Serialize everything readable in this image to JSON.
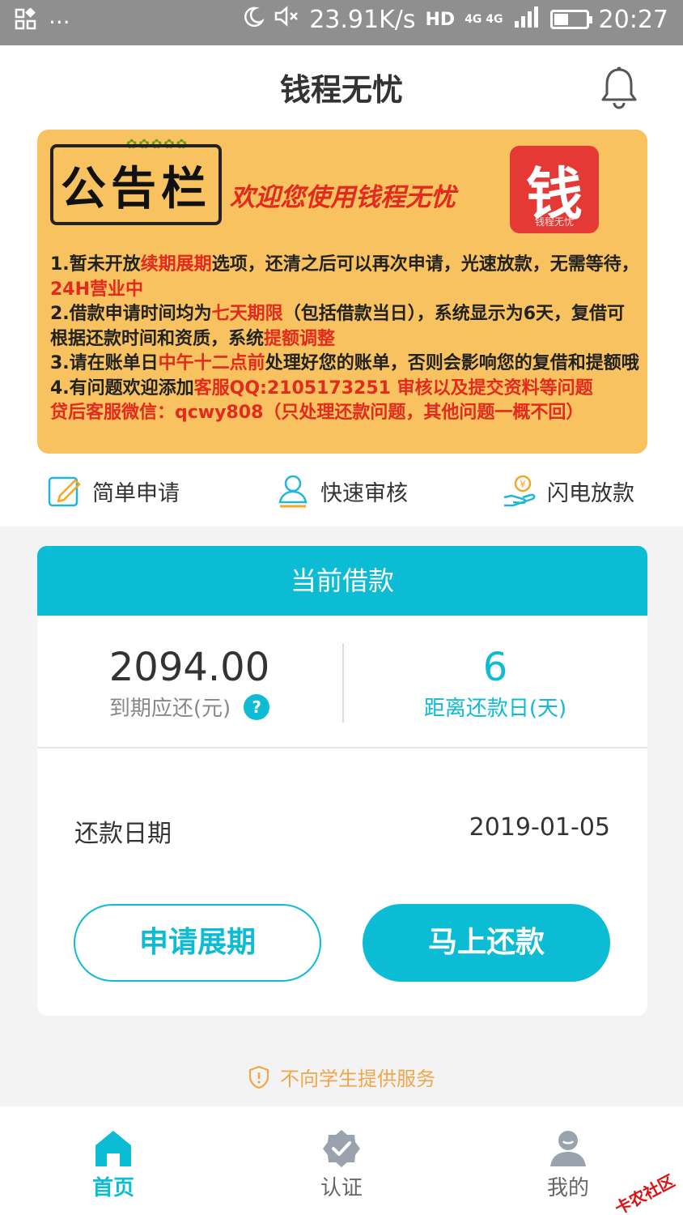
{
  "status_bar": {
    "speed": "23.91K/s",
    "network": "HD",
    "network_gen": "4G 4G",
    "battery_level": 0.45,
    "time": "20:27"
  },
  "header": {
    "title": "钱程无忧"
  },
  "notice_board": {
    "title": "公告栏",
    "welcome": "欢迎您使用钱程无忧",
    "logo_char": "钱",
    "logo_sub": "钱程无忧",
    "line1_a": "1.暂未开放",
    "line1_b": "续期展期",
    "line1_c": "选项，还清之后可以再次申请，光速放款，无需等待，",
    "line1_d": "24H营业中",
    "line2_a": "2.借款申请时间均为",
    "line2_b": "七天期限",
    "line2_c": "（包括借款当日），系统显示为6天，复借可根据还款时间和资质，系统",
    "line2_d": "提额调整",
    "line3_a": "3.请在账单日",
    "line3_b": "中午十二点前",
    "line3_c": "处理好您的账单，否则会影响您的复借和提额哦",
    "line4_a": "4.有问题欢迎添加",
    "line4_b": "客服QQ:2105173251  审核以及提交资料等问题",
    "line4_c": "贷后客服微信：qcwy808（只处理还款问题，其他问题一概不回）"
  },
  "features": [
    {
      "label": "简单申请",
      "icon": "edit-icon"
    },
    {
      "label": "快速审核",
      "icon": "user-check-icon"
    },
    {
      "label": "闪电放款",
      "icon": "coin-hand-icon"
    }
  ],
  "loan_card": {
    "title": "当前借款",
    "amount": "2094.00",
    "amount_label": "到期应还(元)",
    "help_icon": "?",
    "days": "6",
    "days_label": "距离还款日(天)",
    "date_label": "还款日期",
    "date_value": "2019-01-05",
    "extend_button": "申请展期",
    "repay_button": "马上还款"
  },
  "footnote": "不向学生提供服务",
  "bottom_nav": [
    {
      "label": "首页",
      "icon": "home-icon",
      "active": true
    },
    {
      "label": "认证",
      "icon": "verify-badge-icon",
      "active": false
    },
    {
      "label": "我的",
      "icon": "profile-icon",
      "active": false
    }
  ],
  "watermark": "卡农社区",
  "colors": {
    "accent": "#0cbcd5",
    "notice_bg": "#f7c25f",
    "notice_highlight": "#e22a1e",
    "warning": "#f0a64a"
  }
}
